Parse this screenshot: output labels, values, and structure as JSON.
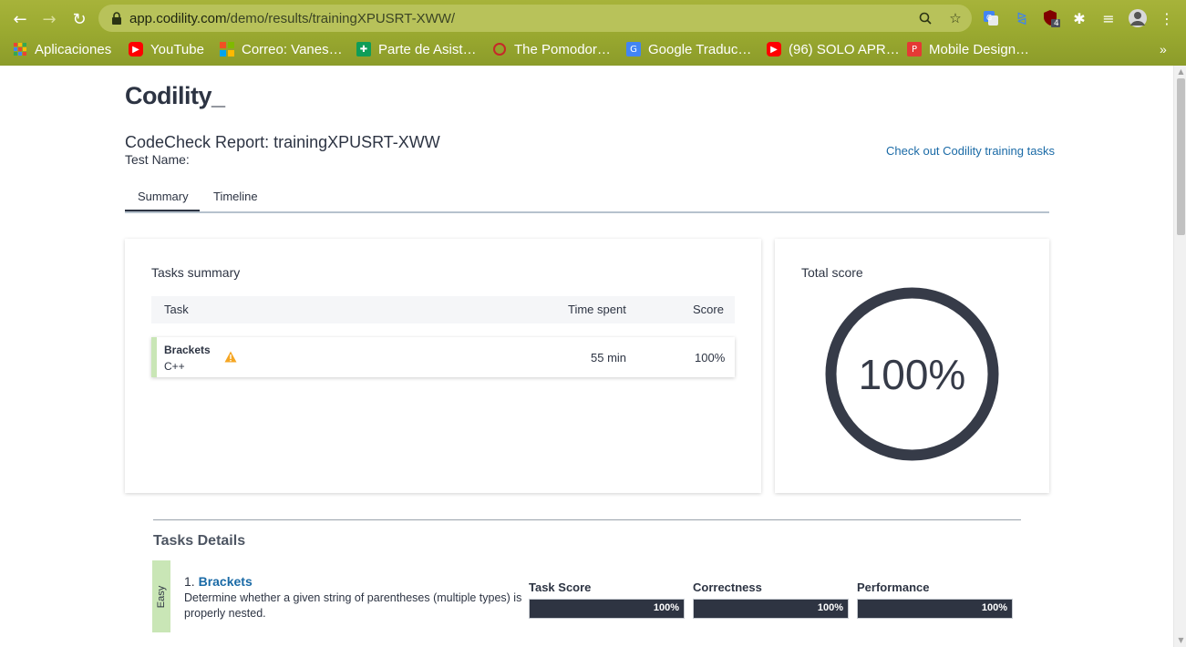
{
  "browser": {
    "url_host": "app.codility.com",
    "url_path": "/demo/results/trainingXPUSRT-XWW/",
    "extension_badge": "4",
    "bookmarks": [
      {
        "label": "Aplicaciones",
        "icon": "apps-grid-icon",
        "color": "#e94235"
      },
      {
        "label": "YouTube",
        "icon": "youtube-icon",
        "color": "#ff0000"
      },
      {
        "label": "Correo: Vanes…",
        "icon": "outlook-icon",
        "color": "#f25022"
      },
      {
        "label": "Parte de Asist…",
        "icon": "sheet-icon",
        "color": "#0f9d58"
      },
      {
        "label": "The Pomodor…",
        "icon": "pomodoro-icon",
        "color": "#c62828"
      },
      {
        "label": "Google Traduc…",
        "icon": "translate-icon",
        "color": "#4285f4"
      },
      {
        "label": "(96) SOLO APR…",
        "icon": "youtube-icon",
        "color": "#ff0000"
      },
      {
        "label": "Mobile Design…",
        "icon": "p-icon",
        "color": "#e53935"
      }
    ]
  },
  "header": {
    "logo": "Codility_",
    "report_title": "CodeCheck Report: trainingXPUSRT-XWW",
    "test_name_label": "Test Name:",
    "training_link": "Check out Codility training tasks"
  },
  "tabs": [
    {
      "label": "Summary",
      "active": true
    },
    {
      "label": "Timeline",
      "active": false
    }
  ],
  "tasks_summary": {
    "title": "Tasks summary",
    "columns": {
      "task": "Task",
      "time": "Time spent",
      "score": "Score"
    },
    "rows": [
      {
        "name": "Brackets",
        "language": "C++",
        "time": "55 min",
        "score": "100%",
        "warning": true
      }
    ]
  },
  "total_score": {
    "title": "Total score",
    "value": "100%",
    "percent": 100
  },
  "task_details": {
    "title": "Tasks Details",
    "tasks": [
      {
        "difficulty": "Easy",
        "number": "1.",
        "name": "Brackets",
        "description": "Determine whether a given string of parentheses (multiple types) is properly nested.",
        "metrics": [
          {
            "label": "Task Score",
            "value": "100%",
            "percent": 100
          },
          {
            "label": "Correctness",
            "value": "100%",
            "percent": 100
          },
          {
            "label": "Performance",
            "value": "100%",
            "percent": 100
          }
        ]
      }
    ]
  },
  "colors": {
    "accent": "#1a6aa6",
    "dark": "#2d3443",
    "easy": "#c9e6b6",
    "warning": "#f5a623"
  }
}
